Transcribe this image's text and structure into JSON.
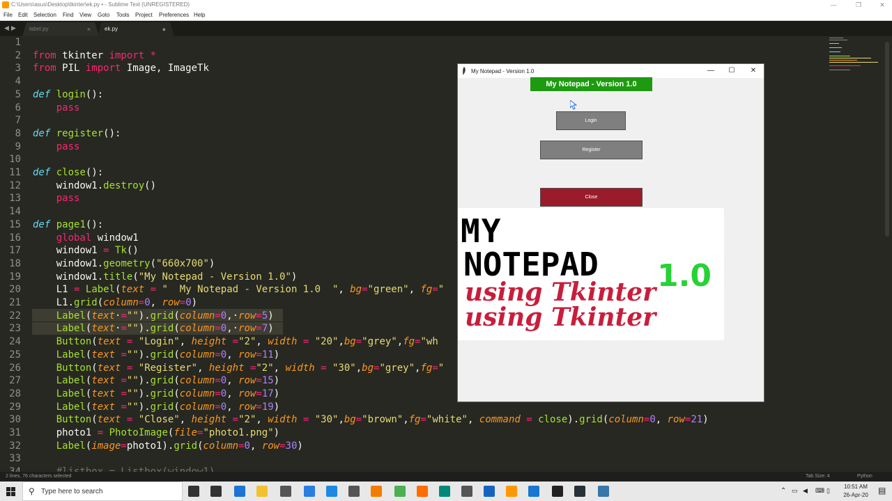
{
  "window": {
    "title": "C:\\Users\\asus\\Desktop\\tkinter\\ek.py • - Sublime Text (UNREGISTERED)",
    "min_glyph": "—",
    "max_glyph": "❐",
    "close_glyph": "✕"
  },
  "menu": [
    "File",
    "Edit",
    "Selection",
    "Find",
    "View",
    "Goto",
    "Tools",
    "Project",
    "Preferences",
    "Help"
  ],
  "tabs": [
    {
      "label": "label.py",
      "close": "×"
    },
    {
      "label": "ek.py",
      "close": "●"
    }
  ],
  "tab_arrows": {
    "left": "◀",
    "right": "▶"
  },
  "code_lines": [
    {
      "n": "1",
      "text": ""
    },
    {
      "n": "2",
      "text": "from tkinter import *"
    },
    {
      "n": "3",
      "text": "from PIL import Image, ImageTk"
    },
    {
      "n": "4",
      "text": ""
    },
    {
      "n": "5",
      "text": "def login():"
    },
    {
      "n": "6",
      "text": "    pass"
    },
    {
      "n": "7",
      "text": ""
    },
    {
      "n": "8",
      "text": "def register():"
    },
    {
      "n": "9",
      "text": "    pass"
    },
    {
      "n": "10",
      "text": ""
    },
    {
      "n": "11",
      "text": "def close():"
    },
    {
      "n": "12",
      "text": "    window1.destroy()"
    },
    {
      "n": "13",
      "text": "    pass"
    },
    {
      "n": "14",
      "text": ""
    },
    {
      "n": "15",
      "text": "def page1():"
    },
    {
      "n": "16",
      "text": "    global window1"
    },
    {
      "n": "17",
      "text": "    window1 = Tk()"
    },
    {
      "n": "18",
      "text": "    window1.geometry(\"660x700\")"
    },
    {
      "n": "19",
      "text": "    window1.title(\"My Notepad - Version 1.0\")"
    },
    {
      "n": "20",
      "text": "    L1 = Label(text = \"  My Notepad - Version 1.0  \", bg=\"green\", fg=\""
    },
    {
      "n": "21",
      "text": "    L1.grid(column=0, row=0)"
    },
    {
      "n": "22",
      "text": "    Label(text·=\"\").grid(column=0,·row=5)"
    },
    {
      "n": "23",
      "text": "    Label(text·=\"\").grid(column=0,·row=7)"
    },
    {
      "n": "24",
      "text": "    Button(text = \"Login\", height =\"2\", width = \"20\",bg=\"grey\",fg=\"wh"
    },
    {
      "n": "25",
      "text": "    Label(text =\"\").grid(column=0, row=11)"
    },
    {
      "n": "26",
      "text": "    Button(text = \"Register\", height =\"2\", width = \"30\",bg=\"grey\",fg=\""
    },
    {
      "n": "27",
      "text": "    Label(text =\"\").grid(column=0, row=15)"
    },
    {
      "n": "28",
      "text": "    Label(text =\"\").grid(column=0, row=17)"
    },
    {
      "n": "29",
      "text": "    Label(text =\"\").grid(column=0, row=19)"
    },
    {
      "n": "30",
      "text": "    Button(text = \"Close\", height =\"2\", width = \"30\",bg=\"brown\",fg=\"white\", command = close).grid(column=0, row=21)"
    },
    {
      "n": "31",
      "text": "    photo1 = PhotoImage(file=\"photo1.png\")"
    },
    {
      "n": "32",
      "text": "    Label(image=photo1).grid(column=0, row=30)"
    },
    {
      "n": "33",
      "text": ""
    },
    {
      "n": "34",
      "text": "    #listbox = Listbox(window1)"
    }
  ],
  "status": {
    "left": "2 lines, 76 characters selected",
    "tab_size": "Tab Size: 4",
    "syntax": "Python"
  },
  "tk_window": {
    "title": "My Notepad - Version 1.0",
    "header_label": "My Notepad - Version 1.0",
    "header_bg": "#1e9a10",
    "login_label": "Login",
    "register_label": "Register",
    "close_label": "Close",
    "grey_button_bg": "#7f7f7f",
    "close_button_bg": "#9a1c2a",
    "banner": {
      "line1": "MY",
      "line2": "NOTEPAD",
      "version": "1.0",
      "subtitle1": "using Tkinter",
      "subtitle2": "using Tkinter"
    }
  },
  "taskbar": {
    "search_placeholder": "Type here to search",
    "time": "10:51 AM",
    "date": "26-Apr-20",
    "icons": [
      "cortana-icon",
      "task-view-icon",
      "edge-icon",
      "file-explorer-icon",
      "store-icon",
      "mail-icon",
      "photos-icon",
      "snip-icon",
      "search-app-icon",
      "chrome-icon",
      "firefox-icon",
      "maps-icon",
      "package-icon",
      "am-app-icon",
      "sublime-icon",
      "notepad-icon",
      "cmd-icon",
      "terminal-icon",
      "python-icon"
    ]
  },
  "colors": {
    "editor_bg": "#272822",
    "keyword": "#f92672",
    "function": "#a6e22e",
    "string": "#e6db74",
    "param": "#fd971f",
    "number": "#ae81ff",
    "def": "#66d9ef"
  }
}
